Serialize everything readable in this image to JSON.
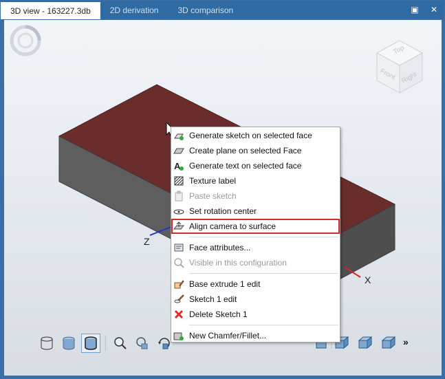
{
  "tabs": [
    {
      "label": "3D view - 163227.3db",
      "active": true
    },
    {
      "label": "2D derivation",
      "active": false
    },
    {
      "label": "3D comparison",
      "active": false
    }
  ],
  "window_buttons": {
    "maximize": "▣",
    "close": "✕"
  },
  "viewcube": {
    "top": "Top",
    "front": "Front",
    "right": "Right"
  },
  "axes": {
    "x": "X",
    "z": "Z"
  },
  "colors": {
    "tab_bar": "#2f6aa3",
    "face_top": "#6b2c2c",
    "face_side": "#5a5a5a",
    "highlight": "#d42a2a",
    "accent": "#3b6ea5"
  },
  "context_menu": {
    "groups": [
      [
        {
          "label": "Generate sketch on selected face",
          "icon": "sketch-face-icon",
          "disabled": false
        },
        {
          "label": "Create plane on selected Face",
          "icon": "plane-icon",
          "disabled": false
        },
        {
          "label": "Generate text on selected face",
          "icon": "text-face-icon",
          "disabled": false
        },
        {
          "label": "Texture label",
          "icon": "texture-icon",
          "disabled": false
        },
        {
          "label": "Paste sketch",
          "icon": "paste-icon",
          "disabled": true
        },
        {
          "label": "Set rotation center",
          "icon": "rotation-center-icon",
          "disabled": false
        },
        {
          "label": "Align camera to surface",
          "icon": "align-camera-icon",
          "disabled": false,
          "highlighted": true
        }
      ],
      [
        {
          "label": "Face attributes...",
          "icon": "face-attributes-icon",
          "disabled": false
        },
        {
          "label": "Visible in this configuration",
          "icon": "visibility-icon",
          "disabled": true
        }
      ],
      [
        {
          "label": "Base extrude 1 edit",
          "icon": "extrude-edit-icon",
          "disabled": false
        },
        {
          "label": "Sketch 1 edit",
          "icon": "sketch-edit-icon",
          "disabled": false
        },
        {
          "label": "Delete Sketch 1",
          "icon": "delete-icon",
          "disabled": false
        }
      ],
      [
        {
          "label": "New Chamfer/Fillet...",
          "icon": "chamfer-icon",
          "disabled": false
        }
      ]
    ]
  },
  "toolbar": {
    "more_label": "»"
  }
}
